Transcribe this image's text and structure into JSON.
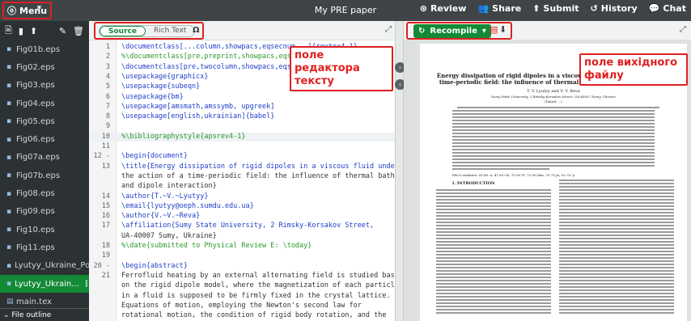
{
  "topbar": {
    "menu_label": "Menu",
    "project_title": "My PRE paper",
    "review_label": "Review",
    "share_label": "Share",
    "submit_label": "Submit",
    "history_label": "History",
    "chat_label": "Chat"
  },
  "sidebar": {
    "files": [
      {
        "name": "Fig01b.eps",
        "active": false
      },
      {
        "name": "Fig02.eps",
        "active": false
      },
      {
        "name": "Fig03.eps",
        "active": false
      },
      {
        "name": "Fig04.eps",
        "active": false
      },
      {
        "name": "Fig05.eps",
        "active": false
      },
      {
        "name": "Fig06.eps",
        "active": false
      },
      {
        "name": "Fig07a.eps",
        "active": false
      },
      {
        "name": "Fig07b.eps",
        "active": false
      },
      {
        "name": "Fig08.eps",
        "active": false
      },
      {
        "name": "Fig09.eps",
        "active": false
      },
      {
        "name": "Fig10.eps",
        "active": false
      },
      {
        "name": "Fig11.eps",
        "active": false
      },
      {
        "name": "Lyutyy_Ukraine_Po...",
        "active": false
      },
      {
        "name": "Lyutyy_Ukrain...",
        "active": true
      },
      {
        "name": "main.tex",
        "active": false
      }
    ],
    "outline_label": "File outline"
  },
  "editor": {
    "source_label": "Source",
    "rich_label": "Rich Text",
    "symbol_label": "Ω",
    "callout": "поле редактора текстy",
    "lines": [
      {
        "n": "1",
        "t": "\\documentclass[...column,showpacs,eqsecnum...]{revtex4-1}",
        "k": "cmd"
      },
      {
        "n": "2",
        "t": "%\\documentclass[pre,preprint,showpacs,eqs...",
        "k": "cmt"
      },
      {
        "n": "3",
        "t": "\\documentclass[pre,twocolumn,showpacs,eqs...",
        "k": "cmd"
      },
      {
        "n": "4",
        "t": "\\usepackage{graphicx}",
        "k": "cmd"
      },
      {
        "n": "5",
        "t": "\\usepackage{subeqn}",
        "k": "cmd"
      },
      {
        "n": "6",
        "t": "\\usepackage{bm}",
        "k": "cmd"
      },
      {
        "n": "7",
        "t": "\\usepackage[amsmath,amssymb, upgreek]",
        "k": "cmd"
      },
      {
        "n": "8",
        "t": "\\usepackage[english,ukrainian]{babel}",
        "k": "cmd"
      },
      {
        "n": "9",
        "t": "",
        "k": "txt"
      },
      {
        "n": "10",
        "t": "%\\bibliographystyle{apsrev4-1}",
        "k": "cmt"
      },
      {
        "n": "11",
        "t": "",
        "k": "txt"
      },
      {
        "n": "12 -",
        "t": "\\begin{document}",
        "k": "cmd"
      },
      {
        "n": "13",
        "t": "\\title{Energy dissipation of rigid dipoles in a viscous fluid under",
        "k": "cmd"
      },
      {
        "n": "",
        "t": "the action of a time-periodic field: the influence of thermal bath",
        "k": "txt"
      },
      {
        "n": "",
        "t": "and dipole interaction}",
        "k": "txt"
      },
      {
        "n": "14",
        "t": "\\author{T.~V.~Lyutyy}",
        "k": "cmd"
      },
      {
        "n": "15",
        "t": "\\email{lyutyy@oeph.sumdu.edu.ua}",
        "k": "cmd"
      },
      {
        "n": "16",
        "t": "\\author{V.~V.~Reva}",
        "k": "cmd"
      },
      {
        "n": "17",
        "t": "\\affiliation{Sumy State University, 2 Rimsky-Korsakov Street,",
        "k": "cmd"
      },
      {
        "n": "",
        "t": "UA-40007 Sumy, Ukraine}",
        "k": "txt"
      },
      {
        "n": "18",
        "t": "%\\date{submitted to Physical Review E: \\today}",
        "k": "cmt"
      },
      {
        "n": "19",
        "t": "",
        "k": "txt"
      },
      {
        "n": "20 -",
        "t": "\\begin{abstract}",
        "k": "cmd"
      },
      {
        "n": "21",
        "t": "Ferrofluid heating by an external alternating field is studied based",
        "k": "txt"
      },
      {
        "n": "",
        "t": "on the rigid dipole model, where the magnetization of each particle",
        "k": "txt"
      },
      {
        "n": "",
        "t": "in a fluid is supposed to be firmly fixed in the crystal lattice.",
        "k": "txt"
      },
      {
        "n": "",
        "t": "Equations of motion, employing the Newton's second law for",
        "k": "txt"
      },
      {
        "n": "",
        "t": "rotational motion, the condition of rigid body rotation, and the",
        "k": "txt"
      },
      {
        "n": "",
        "t": "assumption that the friction torque is proportional to angular",
        "k": "txt"
      }
    ]
  },
  "preview": {
    "recompile_label": "Recompile",
    "callout": "поле вихідного файлу",
    "title": "Energy dissipation of rigid dipoles in a viscous fluid under the action of a time-periodic field: the influence of thermal bath and dipole interaction",
    "authors": "T. V. Lyutyy and V. V. Reva",
    "affiliation": "Sumy State University, 2 Rimsky-Korsakov Street, UA-40007 Sumy, Ukraine",
    "date": "(Dated: ...)",
    "pacs": "PACS numbers: 05.40.-a, 47.65.Cb, 75.50.Tt, 75.50.Mm, 75.75.Jn, 82.70.-y",
    "section": "I. INTRODUCTION"
  }
}
